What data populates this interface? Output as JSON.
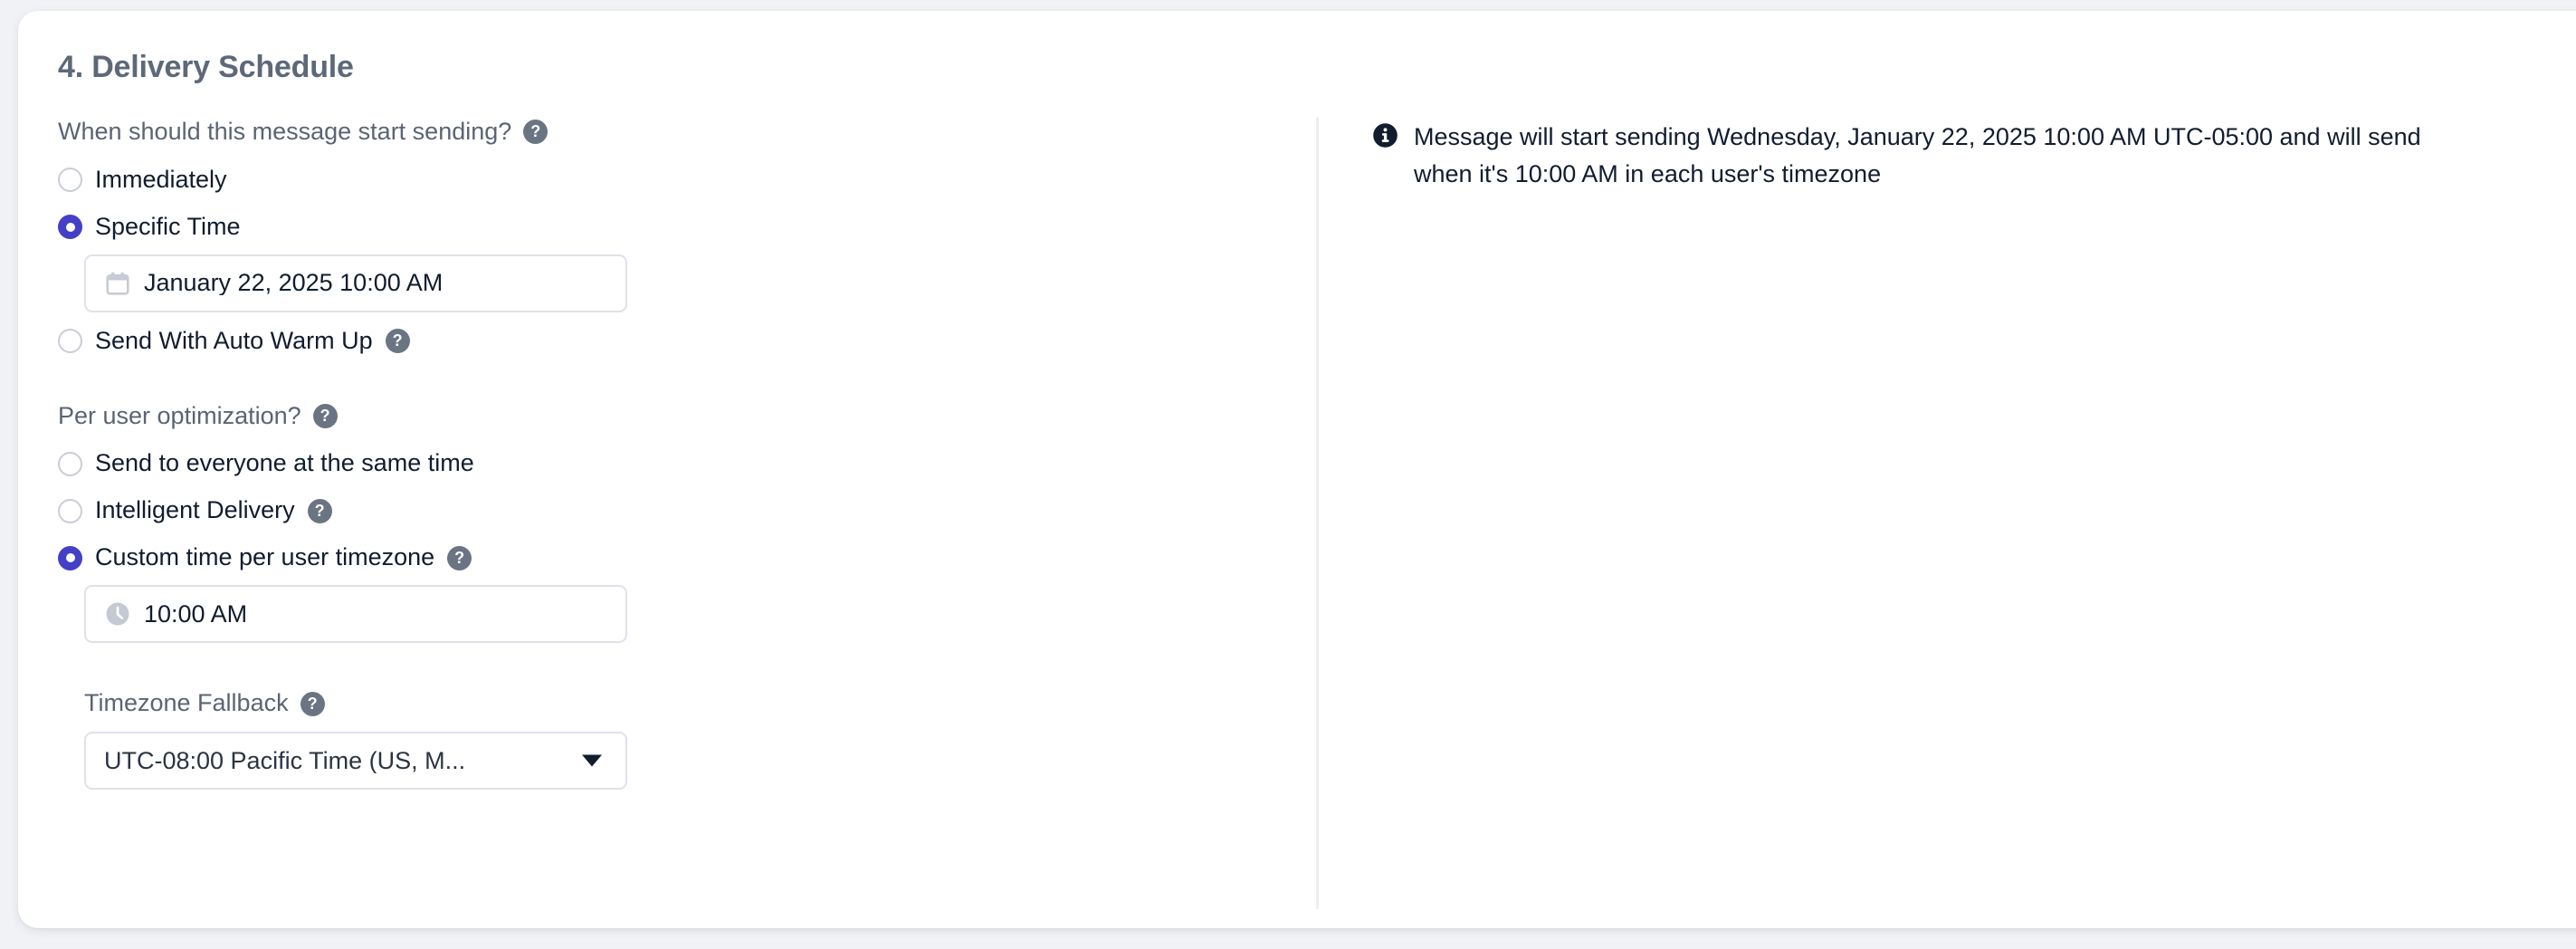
{
  "section": {
    "heading": "4. Delivery Schedule"
  },
  "colors": {
    "accent": "#4340c7",
    "page_background": "#f1f2f5",
    "card_background": "#ffffff",
    "heading_text": "#5d6878",
    "label_text": "#5b6473",
    "body_text": "#111c2f",
    "help_icon_background": "#6b7483",
    "info_icon_background": "#111c2f",
    "border": "#dfe2e8",
    "divider": "#eceef2"
  },
  "start_sending": {
    "label": "When should this message start sending?",
    "help_icon": "help-circle-icon",
    "options": [
      {
        "label": "Immediately",
        "selected": false,
        "help_icon": null
      },
      {
        "label": "Specific Time",
        "selected": true,
        "help_icon": null
      },
      {
        "label": "Send With Auto Warm Up",
        "selected": false,
        "help_icon": "help-circle-icon"
      }
    ],
    "datetime_input": {
      "icon": "calendar-icon",
      "value": "January 22, 2025 10:00 AM"
    }
  },
  "per_user_optimization": {
    "label": "Per user optimization?",
    "help_icon": "help-circle-icon",
    "options": [
      {
        "label": "Send to everyone at the same time",
        "selected": false,
        "help_icon": null
      },
      {
        "label": "Intelligent Delivery",
        "selected": false,
        "help_icon": "help-circle-icon"
      },
      {
        "label": "Custom time per user timezone",
        "selected": true,
        "help_icon": "help-circle-icon"
      }
    ],
    "time_input": {
      "icon": "clock-icon",
      "value": "10:00 AM"
    },
    "timezone_fallback": {
      "label": "Timezone Fallback",
      "help_icon": "help-circle-icon",
      "selected_value": "UTC-08:00 Pacific Time (US, M...",
      "caret_icon": "chevron-down-icon"
    }
  },
  "info_note": {
    "icon": "info-circle-icon",
    "text": "Message will start sending Wednesday, January 22, 2025 10:00 AM UTC-05:00 and will send when it's 10:00 AM in each user's timezone"
  },
  "help_glyph": "?"
}
